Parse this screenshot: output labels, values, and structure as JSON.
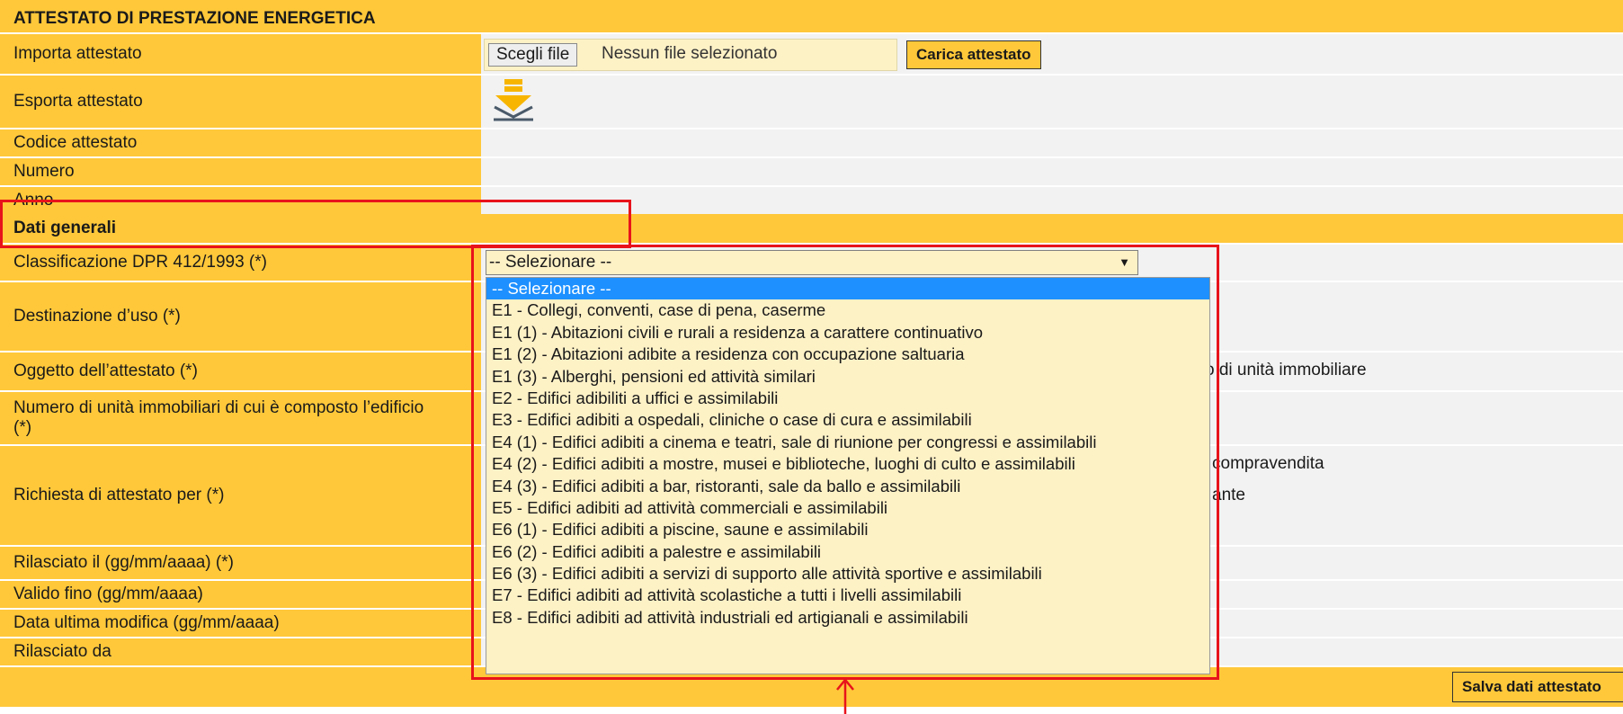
{
  "header": {
    "title": "ATTESTATO DI PRESTAZIONE ENERGETICA"
  },
  "rows": {
    "importa": "Importa attestato",
    "esporta": "Esporta attestato",
    "codice": "Codice attestato",
    "numero": "Numero",
    "anno": "Anno",
    "dati_generali": "Dati generali",
    "classificazione": "Classificazione DPR 412/1993 (*)",
    "destinazione": "Destinazione d’uso (*)",
    "oggetto": "Oggetto dell’attestato (*)",
    "numero_unita": "Numero di unità immobiliari di cui è composto l’edificio (*)",
    "richiesta": "Richiesta di attestato per (*)",
    "rilasciato_il": "Rilasciato il (gg/mm/aaaa) (*)",
    "valido_fino": "Valido fino (gg/mm/aaaa)",
    "data_modifica": "Data ultima modifica (gg/mm/aaaa)",
    "rilasciato_da": "Rilasciato da"
  },
  "file_input": {
    "button_label": "Scegli file",
    "status": "Nessun file selezionato"
  },
  "buttons": {
    "carica": "Carica attestato",
    "salva": "Salva dati attestato"
  },
  "icons": {
    "export": "download-tray-icon",
    "select_arrow": "triangle-down-icon"
  },
  "classificazione_select": {
    "selected": "-- Selezionare --",
    "options": [
      "-- Selezionare --",
      "E1 - Collegi, conventi, case di pena, caserme",
      "E1 (1) - Abitazioni civili e rurali a residenza a carattere continuativo",
      "E1 (2) - Abitazioni adibite a residenza con occupazione saltuaria",
      "E1 (3) - Alberghi, pensioni ed attività similari",
      "E2 - Edifici adibiliti a uffici e assimilabili",
      "E3 - Edifici adibiti a ospedali, cliniche o case di cura e assimilabili",
      "E4 (1) - Edifici adibiti a cinema e teatri, sale di riunione per congressi e assimilabili",
      "E4 (2) - Edifici adibiti a mostre, musei e biblioteche, luoghi di culto e assimilabili",
      "E4 (3) - Edifici adibiti a bar, ristoranti, sale da ballo e assimilabili",
      "E5 - Edifici adibiti ad attività commerciali e assimilabili",
      "E6 (1) - Edifici adibiti a piscine, saune e assimilabili",
      "E6 (2) - Edifici adibiti a palestre e assimilabili",
      "E6 (3) - Edifici adibiti a servizi di supporto alle attività sportive e assimilabili",
      "E7 - Edifici adibiti ad attività scolastiche a tutti i livelli assimilabili",
      "E8 - Edifici adibiti ad attività industriali ed artigianali e assimilabili"
    ]
  },
  "partially_hidden": {
    "oggetto_suffix": "o di unità immobiliare",
    "richiesta_suffix_1": "compravendita",
    "richiesta_suffix_2": "ante"
  },
  "colors": {
    "accent": "#ffc83a",
    "highlight": "#e8131b",
    "selected_option": "#1e90ff"
  }
}
